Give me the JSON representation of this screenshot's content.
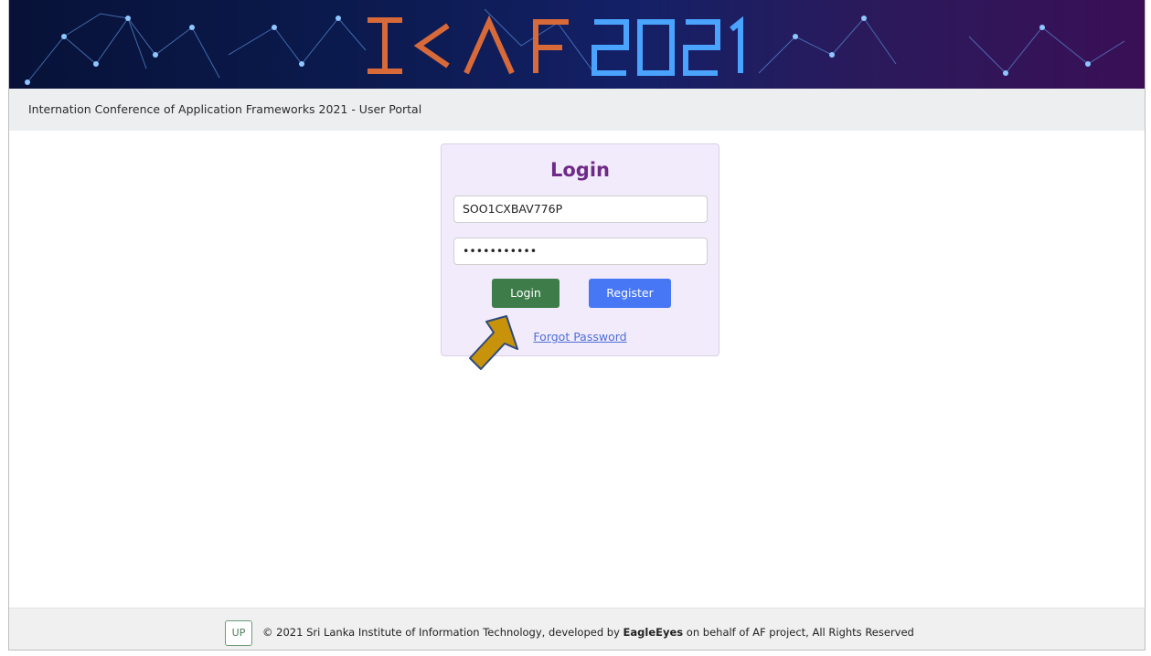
{
  "banner": {
    "logo_text": "I<AF2021"
  },
  "header": {
    "portal_title": "Internation Conference of Application Frameworks 2021 - User Portal"
  },
  "login": {
    "title": "Login",
    "username_value": "SOO1CXBAV776P",
    "password_value": "•••••••••••",
    "login_label": "Login",
    "register_label": "Register",
    "forgot_label": "Forgot Password"
  },
  "footer": {
    "badge": "UP",
    "text_before": "© 2021 Sri Lanka Institute of Information Technology, developed by ",
    "brand": "EagleEyes",
    "text_after": " on behalf of AF project, All Rights Reserved"
  },
  "colors": {
    "accent_title": "#6f2a88",
    "login_button": "#3e7d4a",
    "register_button": "#4777f5",
    "pointer_arrow": "#c8930a"
  },
  "icons": {
    "pointer": "pointer-arrow-icon"
  }
}
